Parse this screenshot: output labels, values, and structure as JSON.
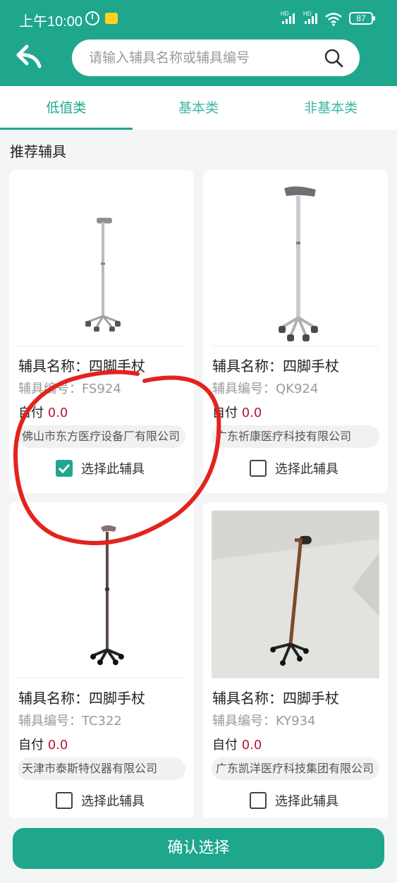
{
  "status_bar": {
    "time": "上午10:00",
    "hd1": "HD",
    "hd2": "HD",
    "battery": "87"
  },
  "header": {
    "search_placeholder": "请输入辅具名称或辅具编号",
    "accent_color": "#1fa78e"
  },
  "tabs": [
    {
      "label": "低值类",
      "active": true
    },
    {
      "label": "基本类",
      "active": false
    },
    {
      "label": "非基本类",
      "active": false
    }
  ],
  "section_title": "推荐辅具",
  "cards": [
    {
      "name": "辅具名称：四脚手杖",
      "code": "辅具编号：FS924",
      "pay_label": "自付",
      "price": "0.0",
      "company": "佛山市东方医疗设备厂有限公司",
      "choose_label": "选择此辅具",
      "selected": true
    },
    {
      "name": "辅具名称：四脚手杖",
      "code": "辅具编号：QK924",
      "pay_label": "自付",
      "price": "0.0",
      "company": "广东祈康医疗科技有限公司",
      "choose_label": "选择此辅具",
      "selected": false
    },
    {
      "name": "辅具名称：四脚手杖",
      "code": "辅具编号：TC322",
      "pay_label": "自付",
      "price": "0.0",
      "company": "天津市泰斯特仪器有限公司",
      "choose_label": "选择此辅具",
      "selected": false
    },
    {
      "name": "辅具名称：四脚手杖",
      "code": "辅具编号：KY934",
      "pay_label": "自付",
      "price": "0.0",
      "company": "广东凯洋医疗科技集团有限公司",
      "choose_label": "选择此辅具",
      "selected": false
    }
  ],
  "confirm_label": "确认选择"
}
